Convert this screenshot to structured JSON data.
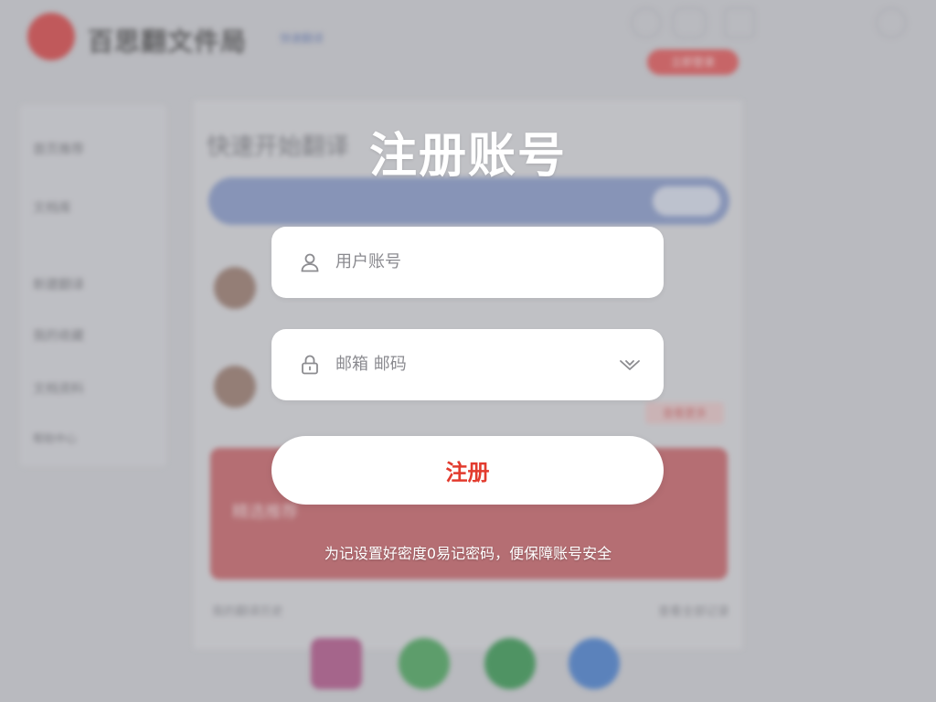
{
  "background": {
    "logo_text": "百思翻文件局",
    "header_sub": "快速翻译",
    "header_pill": "立即登录",
    "sidebar_items": [
      {
        "label": "首页推荐"
      },
      {
        "label": "文档库"
      },
      {
        "label": "新建翻译"
      },
      {
        "label": "我的收藏"
      },
      {
        "label": "文档资料"
      },
      {
        "label": "帮助中心"
      }
    ],
    "main_title": "快速开始翻译",
    "tag_label": "查看更多",
    "banner_text": "精选推荐",
    "footer_left": "我的翻译历史",
    "footer_right": "查看全部记录"
  },
  "modal": {
    "title": "注册账号",
    "username_placeholder": "用户账号",
    "password_placeholder": "邮箱 邮码",
    "submit_label": "注册",
    "hint": "为记设置好密度0易记密码，便保障账号安全"
  },
  "colors": {
    "accent": "#e23b2e",
    "field_bg": "#ffffff",
    "overlay_text": "#ffffff"
  },
  "icons": {
    "username_icon": "user-icon",
    "password_icon": "lock-icon",
    "dropdown_icon": "chevron-down-icon"
  }
}
